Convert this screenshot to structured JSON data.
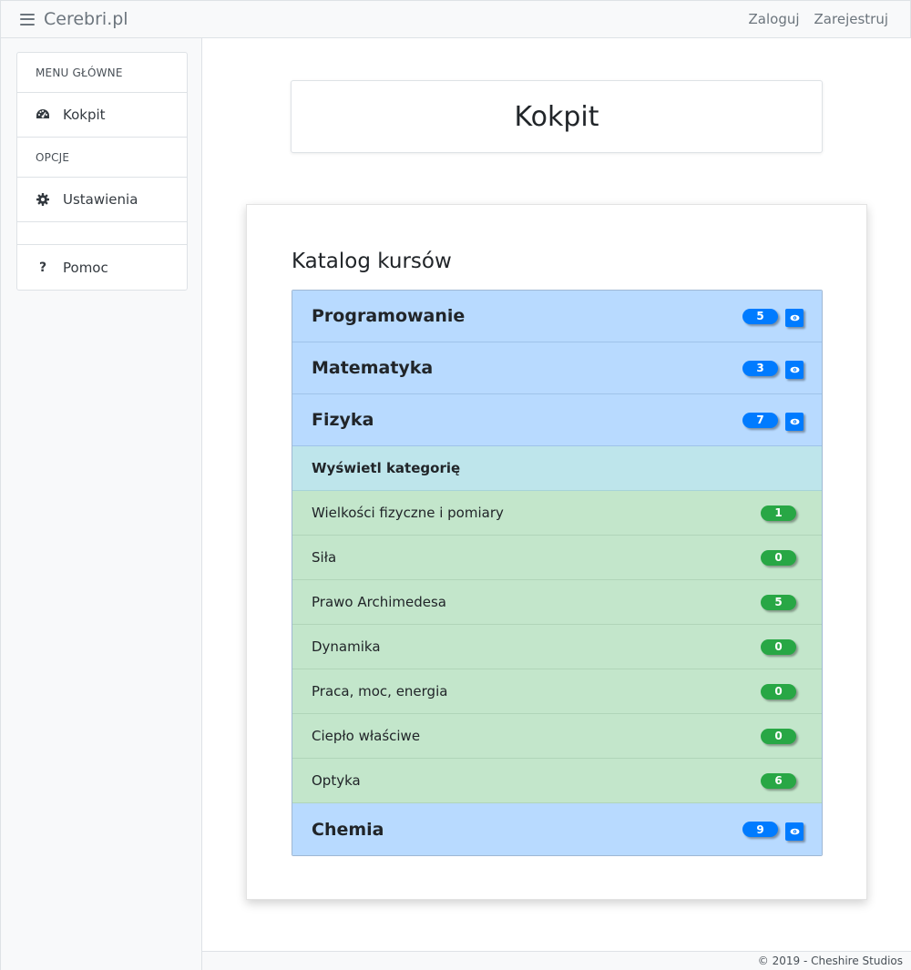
{
  "navbar": {
    "brand": "Cerebri.pl",
    "login": "Zaloguj",
    "register": "Zarejestruj"
  },
  "sidebar": {
    "main_header": "MENU GŁÓWNE",
    "dashboard": "Kokpit",
    "options_header": "OPCJE",
    "settings": "Ustawienia",
    "help": "Pomoc"
  },
  "page": {
    "title": "Kokpit"
  },
  "catalog": {
    "title": "Katalog kursów",
    "categories": [
      {
        "name": "Programowanie",
        "count": "5"
      },
      {
        "name": "Matematyka",
        "count": "3"
      },
      {
        "name": "Fizyka",
        "count": "7"
      },
      {
        "name": "Chemia",
        "count": "9"
      }
    ],
    "expanded": {
      "header": "Wyświetl kategorię",
      "items": [
        {
          "name": "Wielkości fizyczne i pomiary",
          "count": "1"
        },
        {
          "name": "Siła",
          "count": "0"
        },
        {
          "name": "Prawo Archimedesa",
          "count": "5"
        },
        {
          "name": "Dynamika",
          "count": "0"
        },
        {
          "name": "Praca, moc, energia",
          "count": "0"
        },
        {
          "name": "Ciepło właściwe",
          "count": "0"
        },
        {
          "name": "Optyka",
          "count": "6"
        }
      ]
    }
  },
  "footer": {
    "text": "© 2019 - Cheshire Studios"
  },
  "colors": {
    "primary": "#007bff",
    "success": "#28a745",
    "category_bg": "#b8daff",
    "subheader_bg": "#bee5eb",
    "subitem_bg": "#c3e6cb"
  }
}
